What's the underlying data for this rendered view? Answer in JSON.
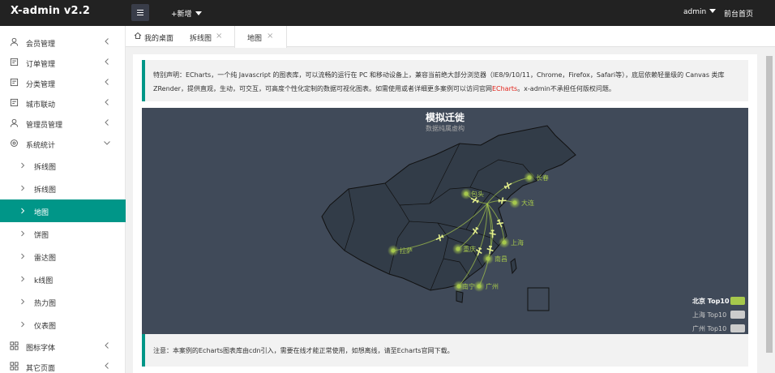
{
  "app": {
    "logo": "X-admin v2.2",
    "new_label": "+新增",
    "user": "admin",
    "front_link": "前台首页"
  },
  "sidebar": {
    "items": [
      {
        "label": "会员管理",
        "icon": "user-icon"
      },
      {
        "label": "订单管理",
        "icon": "order-icon"
      },
      {
        "label": "分类管理",
        "icon": "category-icon"
      },
      {
        "label": "城市联动",
        "icon": "city-icon"
      },
      {
        "label": "管理员管理",
        "icon": "admin-icon"
      },
      {
        "label": "系统统计",
        "icon": "stats-icon"
      }
    ],
    "sub_items": [
      "拆线图",
      "拆线图",
      "地图",
      "饼图",
      "雷达图",
      "k线图",
      "热力图",
      "仪表图"
    ],
    "bottom_items": [
      {
        "label": "图标字体",
        "icon": "grid-icon"
      },
      {
        "label": "其它页面",
        "icon": "grid-icon"
      }
    ],
    "active_sub": "地图"
  },
  "tabs": [
    {
      "label": "我的桌面",
      "icon": "home-icon"
    },
    {
      "label": "拆线图",
      "close": "×"
    },
    {
      "label": "地图",
      "close": "×"
    }
  ],
  "notice": {
    "line1": "特别声明：ECharts，一个纯 Javascript 的图表库，可以流畅的运行在 PC 和移动设备上，兼容当前绝大部分浏览器（IE8/9/10/11，Chrome，Firefox，Safari等），底层依赖轻量级的 Canvas 类库",
    "line2_a": "ZRender，提供直观，生动，可交互，可高度个性化定制的数据可视化图表。如需使用或者详细更多案例可以访问官网",
    "line2_link": "ECharts",
    "line2_b": "。x-admin不承担任何版权问题。"
  },
  "map": {
    "title": "模拟迁徙",
    "subtitle": "数据纯属虚构",
    "origin": "北京",
    "cities": [
      "长春",
      "包头",
      "大连",
      "拉萨",
      "重庆",
      "上海",
      "南昌",
      "南宁",
      "广州"
    ],
    "legend": [
      {
        "label": "北京 Top10",
        "active": true
      },
      {
        "label": "上海 Top10",
        "active": false
      },
      {
        "label": "广州 Top10",
        "active": false
      }
    ],
    "colors": {
      "background": "#404a59",
      "land": "#323c48",
      "border": "#111",
      "line": "#a6c84c"
    }
  },
  "note": "注意：本案例的Echarts图表库由cdn引入，需要在线才能正常使用，如想离线，请至Echarts官网下载。",
  "colors": {
    "accent": "#009688",
    "topbar": "#222222"
  }
}
